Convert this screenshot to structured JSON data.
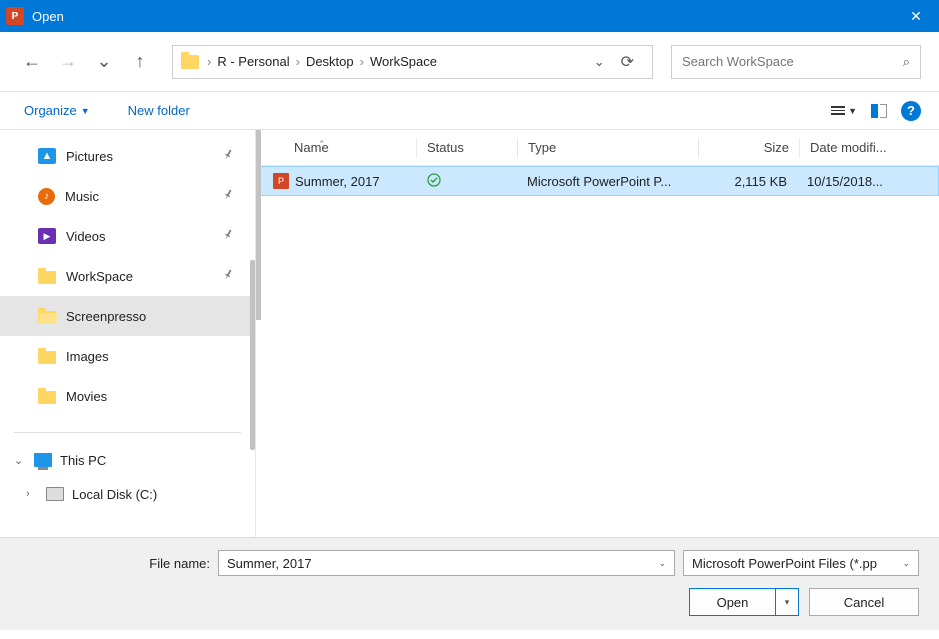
{
  "title": "Open",
  "breadcrumb": [
    "R - Personal",
    "Desktop",
    "WorkSpace"
  ],
  "search_placeholder": "Search WorkSpace",
  "toolbar": {
    "organize": "Organize",
    "new_folder": "New folder"
  },
  "sidebar": {
    "items": [
      {
        "label": "Pictures",
        "icon": "pictures",
        "pinned": true
      },
      {
        "label": "Music",
        "icon": "music",
        "pinned": true
      },
      {
        "label": "Videos",
        "icon": "videos",
        "pinned": true
      },
      {
        "label": "WorkSpace",
        "icon": "folder",
        "pinned": true
      },
      {
        "label": "Screenpresso",
        "icon": "folder-open",
        "selected": true
      },
      {
        "label": "Images",
        "icon": "folder"
      },
      {
        "label": "Movies",
        "icon": "folder"
      }
    ],
    "this_pc": "This PC",
    "local_disk": "Local Disk (C:)"
  },
  "columns": {
    "name": "Name",
    "status": "Status",
    "type": "Type",
    "size": "Size",
    "date": "Date modifi..."
  },
  "files": [
    {
      "name": "Summer, 2017",
      "status_ok": true,
      "type": "Microsoft PowerPoint P...",
      "size": "2,115 KB",
      "date": "10/15/2018...",
      "selected": true
    }
  ],
  "footer": {
    "filename_label": "File name:",
    "filename_value": "Summer, 2017",
    "filter": "Microsoft PowerPoint Files (*.pp",
    "open": "Open",
    "cancel": "Cancel"
  }
}
